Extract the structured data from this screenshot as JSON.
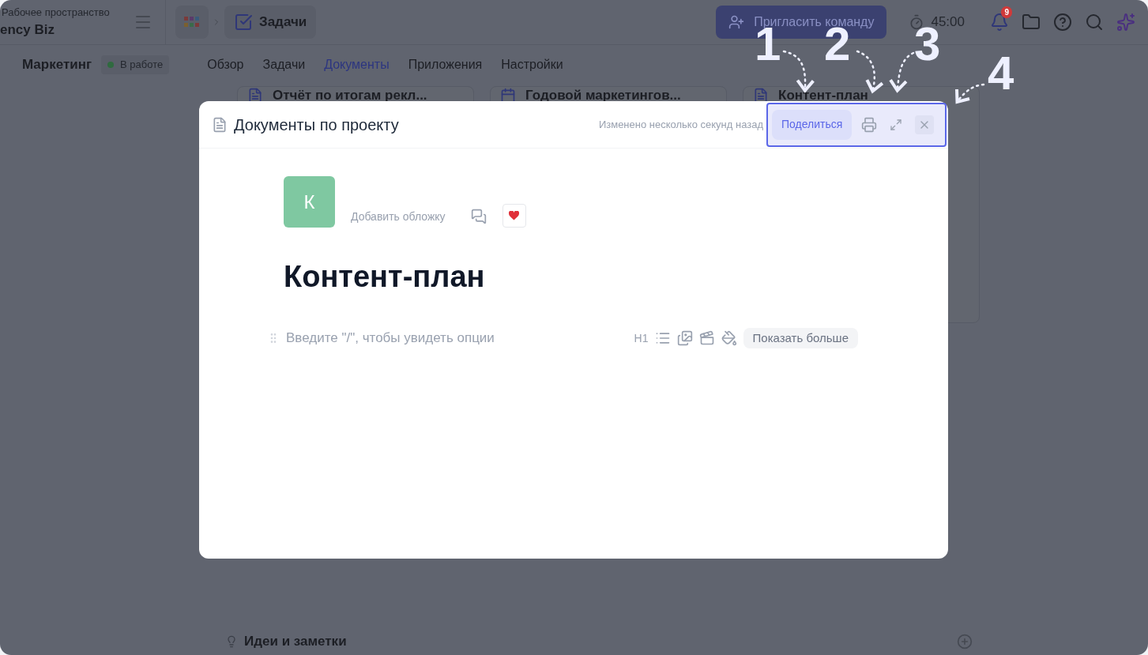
{
  "workspace": {
    "label": "Рабочее пространство",
    "name": "ency Biz"
  },
  "breadcrumb": {
    "title": "Задачи"
  },
  "invite_button": "Пригласить команду",
  "timer": "45:00",
  "notification_count": "9",
  "project": {
    "name": "Маркетинг",
    "status": "В работе"
  },
  "tabs": [
    {
      "label": "Обзор",
      "selected": false
    },
    {
      "label": "Задачи",
      "selected": false
    },
    {
      "label": "Документы",
      "selected": true
    },
    {
      "label": "Приложения",
      "selected": false
    },
    {
      "label": "Настройки",
      "selected": false
    }
  ],
  "doc_cards": [
    "Отчёт по итогам рекл...",
    "Годовой маркетингов...",
    "Контент-план"
  ],
  "section": "Идеи и заметки",
  "modal": {
    "title": "Документы по проекту",
    "modified": "Изменено несколько секунд назад",
    "share": "Поделиться",
    "avatar_letter": "К",
    "add_cover": "Добавить обложку",
    "doc_title": "Контент-план",
    "placeholder": "Введите \"/\", чтобы увидеть опции",
    "heading_tool": "H1",
    "show_more": "Показать больше"
  },
  "annotations": [
    "1",
    "2",
    "3",
    "4"
  ]
}
